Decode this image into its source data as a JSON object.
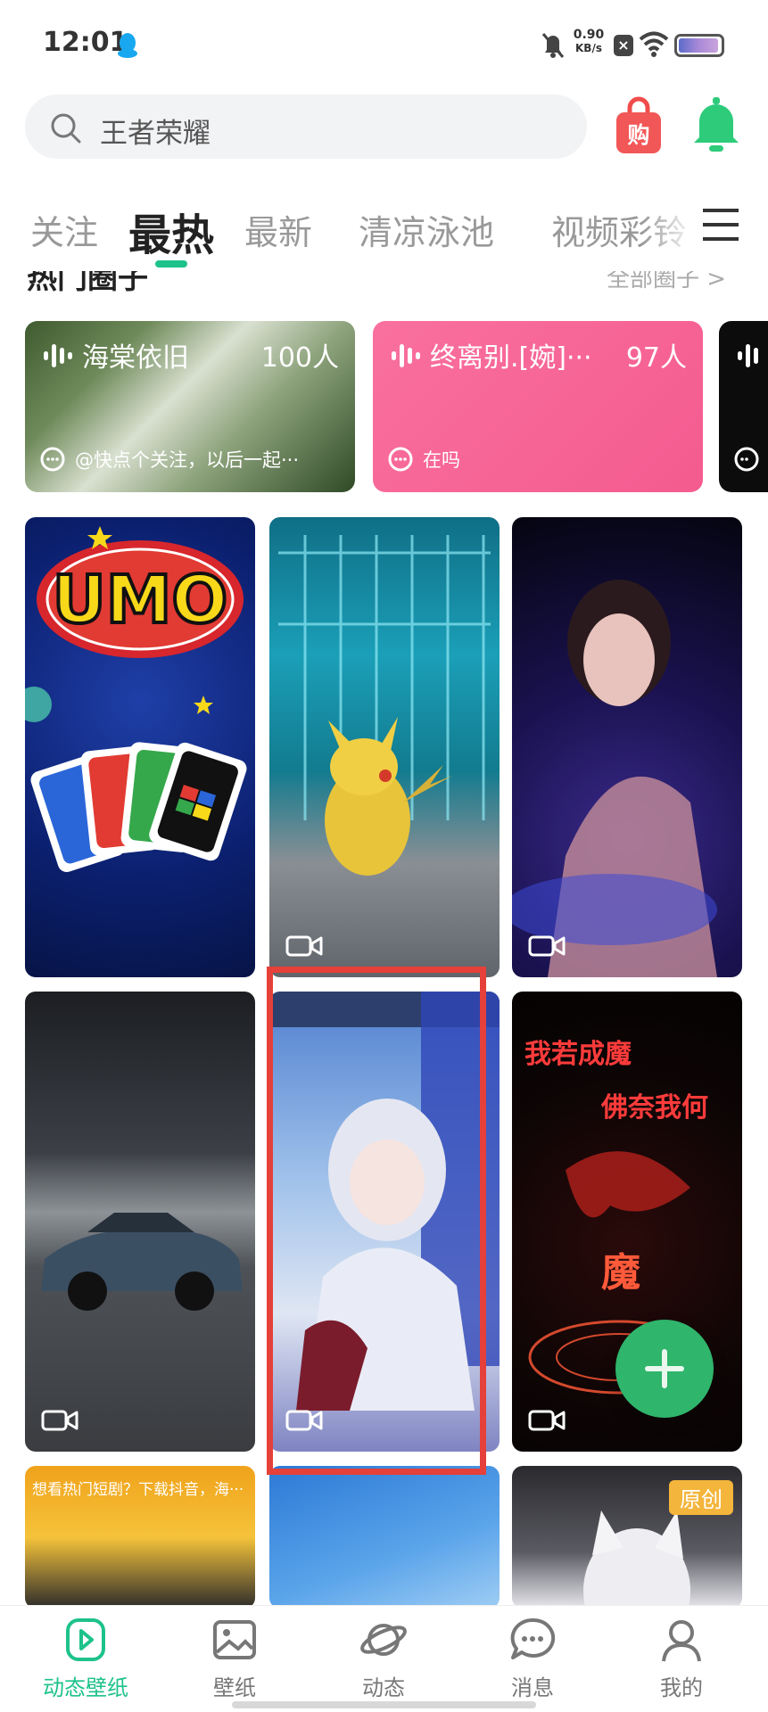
{
  "status_bar": {
    "time": "12:01",
    "net_speed_value": "0.90",
    "net_speed_unit": "KB/s",
    "battery_level": 0.95
  },
  "search": {
    "placeholder": "王者荣耀"
  },
  "header": {
    "shop_label": "购"
  },
  "tabs": [
    {
      "label": "关注",
      "active": false
    },
    {
      "label": "最热",
      "active": true
    },
    {
      "label": "最新",
      "active": false
    },
    {
      "label": "清凉泳池",
      "active": false
    },
    {
      "label": "视频彩铃",
      "active": false
    }
  ],
  "circles_section": {
    "title": "热门圈子",
    "more": "全部圈子 >",
    "items": [
      {
        "name": "海棠依旧",
        "count": "100人",
        "message": "@快点个关注，以后一起···"
      },
      {
        "name": "终离别.[婉]···",
        "count": "97人",
        "message": "在吗"
      },
      {
        "name": "",
        "count": "",
        "message": ""
      }
    ]
  },
  "wallpapers": [
    {
      "title": "UMO",
      "video": false
    },
    {
      "title": "",
      "video": true
    },
    {
      "title": "",
      "video": true
    },
    {
      "title": "",
      "video": true
    },
    {
      "title": "",
      "video": true
    },
    {
      "title": "",
      "video": true,
      "line1": "我若成魔",
      "line2": "佛奈我何",
      "line3": "魔"
    },
    {
      "title": "",
      "promo_text": "想看热门短剧？下载抖音，海···"
    },
    {
      "title": ""
    },
    {
      "title": "",
      "badge": "原创"
    }
  ],
  "bottom_nav": [
    {
      "label": "动态壁纸",
      "icon": "play-square-icon",
      "active": true
    },
    {
      "label": "壁纸",
      "icon": "image-icon",
      "active": false
    },
    {
      "label": "动态",
      "icon": "planet-icon",
      "active": false
    },
    {
      "label": "消息",
      "icon": "chat-icon",
      "active": false
    },
    {
      "label": "我的",
      "icon": "user-icon",
      "active": false
    }
  ],
  "colors": {
    "accent": "#1ec28b",
    "highlight_box": "#e5403a",
    "fab": "#2fb56c",
    "circle_pink": "#f7679a"
  }
}
